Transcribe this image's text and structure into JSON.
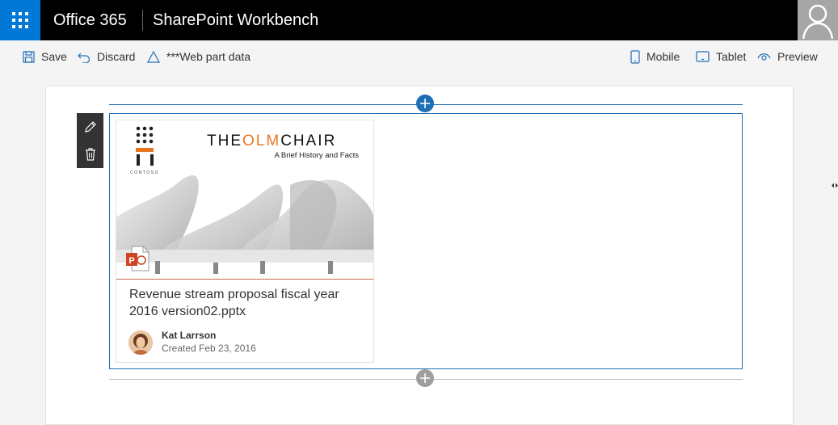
{
  "suitebar": {
    "brand": "Office 365",
    "app_title": "SharePoint Workbench"
  },
  "commands": {
    "save": "Save",
    "discard": "Discard",
    "web_part_data": "***Web part data",
    "mobile": "Mobile",
    "tablet": "Tablet",
    "preview": "Preview"
  },
  "card": {
    "logo_text": "CONTOSO",
    "headline_parts": [
      "THE",
      "OLM",
      "CHAIR"
    ],
    "headline_sub": "A Brief History and Facts",
    "title": "Revenue stream proposal fiscal year 2016 version02.pptx",
    "author": "Kat Larrson",
    "created": "Created Feb 23, 2016",
    "file_type_icon": "powerpoint-icon"
  },
  "colors": {
    "suite_bg": "#000000",
    "waffle_bg": "#0078d7",
    "accent": "#1e6fb8",
    "brand_orange": "#e87722"
  }
}
